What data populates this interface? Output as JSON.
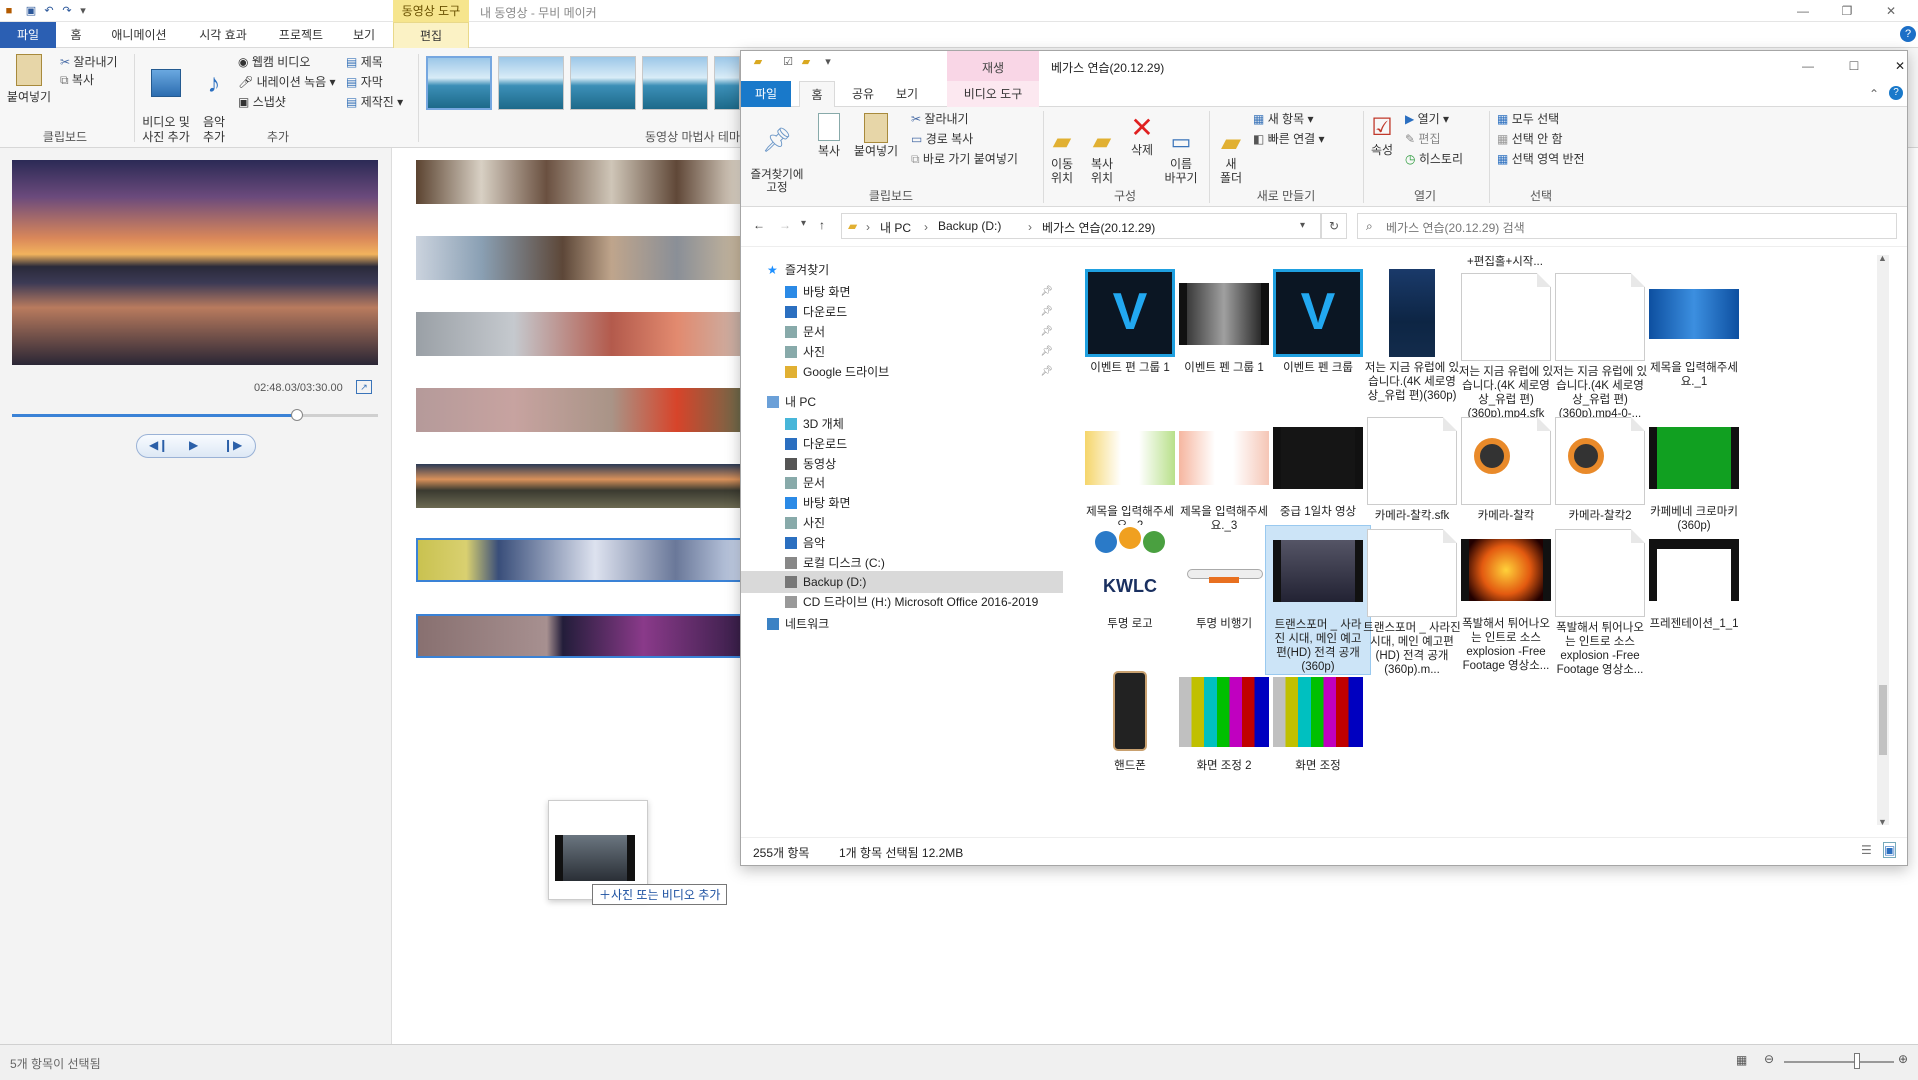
{
  "movie_maker": {
    "title": "내 동영상 - 무비 메이커",
    "context_tab_header": "동영상 도구",
    "tabs": [
      "파일",
      "홈",
      "애니메이션",
      "시각 효과",
      "프로젝트",
      "보기",
      "편집"
    ],
    "ribbon": {
      "clipboard": {
        "paste": "붙여넣기",
        "cut": "잘라내기",
        "copy": "복사",
        "label": "클립보드"
      },
      "add": {
        "video_photo": "비디오 및\n사진 추가",
        "music": "음악\n추가",
        "webcam": "웹캠 비디오",
        "narration": "내레이션 녹음",
        "snapshot": "스냅샷",
        "title": "제목",
        "caption": "자막",
        "credits": "제작진",
        "label": "추가"
      },
      "themes_label": "동영상 마법사 테마"
    },
    "preview_time": "02:48.03/03:30.00",
    "progress_fraction": 0.78,
    "drag_tooltip": "사진 또는 비디오 추가",
    "status": "5개 항목이 선택됨"
  },
  "explorer": {
    "window_title": "베가스 연습(20.12.29)",
    "context_header": "재생",
    "tabs": [
      "파일",
      "홈",
      "공유",
      "보기",
      "비디오 도구"
    ],
    "ribbon": {
      "pin": "즐겨찾기에\n고정",
      "copy": "복사",
      "paste": "붙여넣기",
      "cut": "잘라내기",
      "copy_path": "경로 복사",
      "paste_shortcut": "바로 가기 붙여넣기",
      "clipboard_label": "클립보드",
      "move": "이동\n위치",
      "copyto": "복사\n위치",
      "delete": "삭제",
      "rename": "이름\n바꾸기",
      "organize_label": "구성",
      "new_folder": "새\n폴더",
      "new_item": "새 항목",
      "quick_access": "빠른 연결",
      "new_label": "새로 만들기",
      "properties": "속성",
      "open": "열기",
      "edit": "편집",
      "history": "히스토리",
      "open_label": "열기",
      "select_all": "모두 선택",
      "select_none": "선택 안 함",
      "invert": "선택 영역 반전",
      "select_label": "선택"
    },
    "breadcrumb": [
      "내 PC",
      "Backup (D:)",
      "베가스 연습(20.12.29)"
    ],
    "search_placeholder": "베가스 연습(20.12.29) 검색",
    "nav": {
      "quick": "즐겨찾기",
      "quick_items": [
        "바탕 화면",
        "다운로드",
        "문서",
        "사진",
        "Google 드라이브"
      ],
      "pc": "내 PC",
      "pc_items": [
        "3D 개체",
        "다운로드",
        "동영상",
        "문서",
        "바탕 화면",
        "사진",
        "음악",
        "로컬 디스크 (C:)",
        "Backup (D:)",
        "CD 드라이브 (H:) Microsoft Office 2016-2019"
      ],
      "network": "네트워크"
    },
    "top_label": "+편집홀+시작...",
    "files": [
      {
        "name": "이벤트 편 그룹 1",
        "kind": "vegas"
      },
      {
        "name": "이벤트 펜 그룹 1",
        "kind": "film"
      },
      {
        "name": "이벤트 펜 크룹",
        "kind": "vegas"
      },
      {
        "name": "저는 지금 유럽에 있습니다.(4K 세로영상_유럽 편)(360p)",
        "kind": "poster"
      },
      {
        "name": "저는 지금 유럽에 있습니다.(4K 세로영상_유럽 편)(360p).mp4.sfk",
        "kind": "doc"
      },
      {
        "name": "저는 지금 유럽에 있습니다.(4K 세로영상_유럽 편)(360p).mp4-0-...",
        "kind": "doc"
      },
      {
        "name": "제목을 입력해주세요._1",
        "kind": "banner"
      },
      {
        "name": "제목을 입력해주세요._2",
        "kind": "card1"
      },
      {
        "name": "제목을 입력해주세요._3",
        "kind": "card2"
      },
      {
        "name": "중급 1일차 영상",
        "kind": "darkfilm"
      },
      {
        "name": "카메라-찰칵.sfk",
        "kind": "doc"
      },
      {
        "name": "카메라-찰칵",
        "kind": "audio"
      },
      {
        "name": "카메라-찰칵2",
        "kind": "audio"
      },
      {
        "name": "카페베네 크로마키 (360p)",
        "kind": "green"
      },
      {
        "name": "투명 로고",
        "kind": "kwlc"
      },
      {
        "name": "투명 비행기",
        "kind": "plane"
      },
      {
        "name": "트랜스포머 _ 사라진 시대, 메인 예고편(HD) 전격 공개 (360p)",
        "kind": "trans"
      },
      {
        "name": "트랜스포머 _ 사라진 시대, 메인 예고편(HD) 전격 공개 (360p).m...",
        "kind": "doc"
      },
      {
        "name": "폭발해서 튀어나오는 인트로 소스 explosion -Free Footage 영상소...",
        "kind": "explode"
      },
      {
        "name": "폭발해서 튀어나오는 인트로 소스 explosion -Free Footage 영상소...",
        "kind": "doc"
      },
      {
        "name": "프레젠테이션_1_1",
        "kind": "present"
      },
      {
        "name": "핸드폰",
        "kind": "phone"
      },
      {
        "name": "화면 조정 2",
        "kind": "bars"
      },
      {
        "name": "화면 조정",
        "kind": "bars"
      }
    ],
    "kwlc_text": "KWLC",
    "status_count": "255개 항목",
    "status_selected": "1개 항목 선택됨 12.2MB"
  }
}
